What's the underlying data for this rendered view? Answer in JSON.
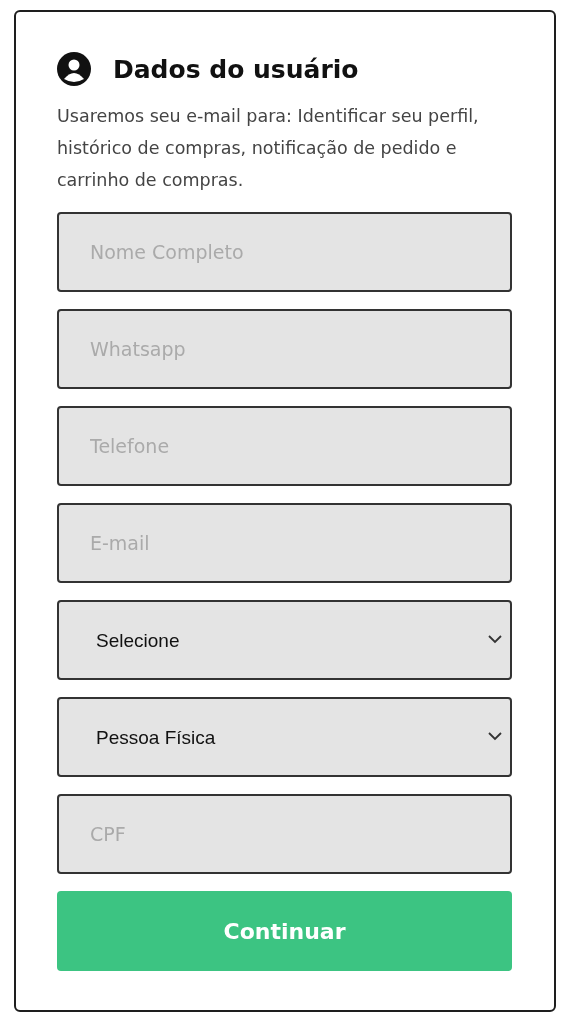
{
  "header": {
    "title": "Dados do usuário"
  },
  "intro": "Usaremos seu e-mail para: Identificar seu perfil, histórico de compras, notificação de pedido e carrinho de compras.",
  "fields": [
    {
      "kind": "text",
      "placeholder": "Nome Completo"
    },
    {
      "kind": "text",
      "placeholder": "Whatsapp"
    },
    {
      "kind": "text",
      "placeholder": "Telefone"
    },
    {
      "kind": "text",
      "placeholder": "E-mail"
    },
    {
      "kind": "select",
      "value": "Selecione"
    },
    {
      "kind": "select",
      "value": "Pessoa Física"
    },
    {
      "kind": "text",
      "placeholder": "CPF"
    }
  ],
  "button": "Continuar"
}
